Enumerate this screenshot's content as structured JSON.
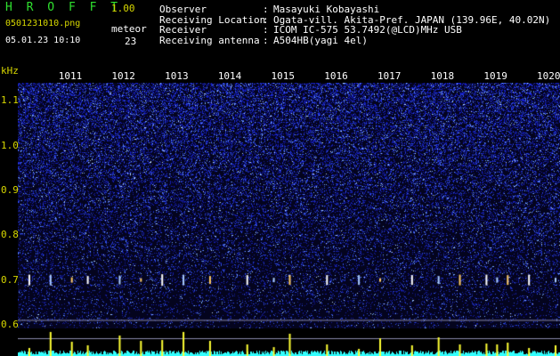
{
  "header": {
    "app_name": "H R O F F T",
    "version": "1.00",
    "file_name": "0501231010.png",
    "meteor_label": "meteor",
    "datetime": "05.01.23 10:10",
    "meteor_count": "23"
  },
  "info": [
    {
      "key": "Observer",
      "value": "Masayuki Kobayashi"
    },
    {
      "key": "Receiving Location",
      "value": "Ogata-vill. Akita-Pref. JAPAN (139.96E, 40.02N)"
    },
    {
      "key": "Receiver",
      "value": "ICOM IC-575 53.7492(@LCD)MHz USB"
    },
    {
      "key": "Receiving antenna",
      "value": "A504HB(yagi 4el)"
    }
  ],
  "chart_data": {
    "type": "heatmap",
    "ylabel": "kHz",
    "y_ticks": [
      "1.1",
      "1.0",
      "0.9",
      "0.8",
      "0.7",
      "0.6"
    ],
    "y_tick_values": [
      1.1,
      1.0,
      0.9,
      0.8,
      0.7,
      0.6
    ],
    "ylim": [
      0.59,
      1.14
    ],
    "time_ticks": [
      "1011",
      "1012",
      "1013",
      "1014",
      "1015",
      "1016",
      "1017",
      "1018",
      "1019",
      "1020"
    ],
    "xlim": [
      1010.0,
      1020.2
    ],
    "meteor_echo_band_khz": 0.7,
    "meteor_times": [
      1010.2,
      1010.6,
      1011.0,
      1011.3,
      1011.9,
      1012.3,
      1012.7,
      1013.1,
      1013.6,
      1014.3,
      1014.8,
      1015.1,
      1015.8,
      1016.4,
      1016.8,
      1017.4,
      1017.9,
      1018.3,
      1018.8,
      1019.0,
      1019.2,
      1019.6,
      1020.1
    ],
    "colors": {
      "background": "#000000",
      "noise_dark": "#05052a",
      "noise_mid": "#1a22c8",
      "noise_bright": "#6fa0ff",
      "signal_meter": "#33ffff",
      "meteor_spike": "#ffff33",
      "label_yellow": "#d8d800",
      "title_green": "#2fe02f"
    }
  }
}
